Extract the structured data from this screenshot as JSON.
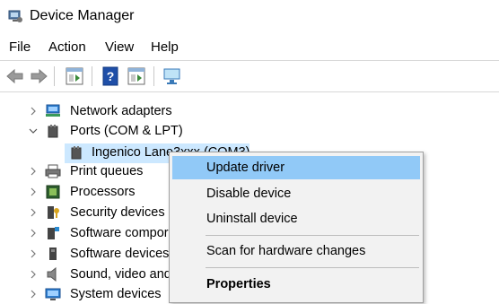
{
  "window": {
    "title": "Device Manager"
  },
  "menu": {
    "items": [
      "File",
      "Action",
      "View",
      "Help"
    ]
  },
  "toolbar": {
    "icons": [
      "back-icon",
      "forward-icon",
      "properties-icon",
      "help-icon",
      "update-icon",
      "scan-icon"
    ]
  },
  "tree": {
    "rows": [
      {
        "label": "Network adapters",
        "expanded": false,
        "icon": "network-icon"
      },
      {
        "label": "Ports (COM & LPT)",
        "expanded": true,
        "icon": "port-icon"
      },
      {
        "label": "Ingenico Lane3xxx (COM3)",
        "child": true,
        "icon": "port-device-icon"
      },
      {
        "label": "Print queues",
        "expanded": false,
        "icon": "printer-icon"
      },
      {
        "label": "Processors",
        "expanded": false,
        "icon": "processor-icon"
      },
      {
        "label": "Security devices",
        "expanded": false,
        "icon": "security-icon"
      },
      {
        "label": "Software compor",
        "expanded": false,
        "icon": "software-component-icon"
      },
      {
        "label": "Software devices",
        "expanded": false,
        "icon": "software-device-icon"
      },
      {
        "label": "Sound, video and",
        "expanded": false,
        "icon": "sound-icon"
      },
      {
        "label": "System devices",
        "expanded": false,
        "icon": "system-icon"
      }
    ]
  },
  "context_menu": {
    "items": [
      "Update driver",
      "Disable device",
      "Uninstall device",
      "Scan for hardware changes",
      "Properties"
    ]
  },
  "colors": {
    "selection": "#cce8ff",
    "menu_highlight": "#91c9f7"
  }
}
